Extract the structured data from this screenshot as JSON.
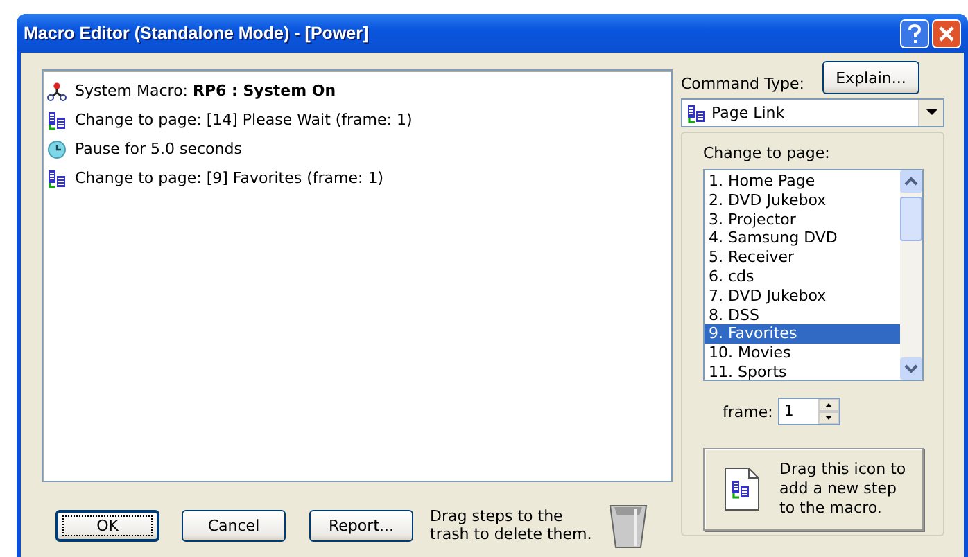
{
  "window": {
    "title": "Macro Editor (Standalone Mode) - [Power]"
  },
  "steps": [
    {
      "kind": "macro",
      "text": "System Macro:   **RP6 : System On**"
    },
    {
      "kind": "page",
      "text": "Change to page: [14] Please Wait (frame: 1)"
    },
    {
      "kind": "pause",
      "text": "Pause for 5.0 seconds"
    },
    {
      "kind": "page",
      "text": "Change to page: [9] Favorites (frame: 1)"
    }
  ],
  "buttons": {
    "ok": "OK",
    "cancel": "Cancel",
    "report": "Report..."
  },
  "trash_hint": "Drag steps to the trash to delete them.",
  "command_type": {
    "label": "Command Type:",
    "explain": "Explain...",
    "value": "Page Link"
  },
  "page_group": {
    "label": "Change to page:",
    "pages": [
      {
        "label": "1. Home Page",
        "selected": false
      },
      {
        "label": "2. DVD Jukebox",
        "selected": false
      },
      {
        "label": "3. Projector",
        "selected": false
      },
      {
        "label": "4. Samsung DVD",
        "selected": false
      },
      {
        "label": "5. Receiver",
        "selected": false
      },
      {
        "label": "6. cds",
        "selected": false
      },
      {
        "label": "7. DVD Jukebox",
        "selected": false
      },
      {
        "label": "8. DSS",
        "selected": false
      },
      {
        "label": "9. Favorites",
        "selected": true
      },
      {
        "label": "10. Movies",
        "selected": false
      },
      {
        "label": "11. Sports",
        "selected": false
      }
    ],
    "frame_label": "frame:",
    "frame_value": "1",
    "drag_hint": "Drag this icon to add a new step to the macro."
  }
}
